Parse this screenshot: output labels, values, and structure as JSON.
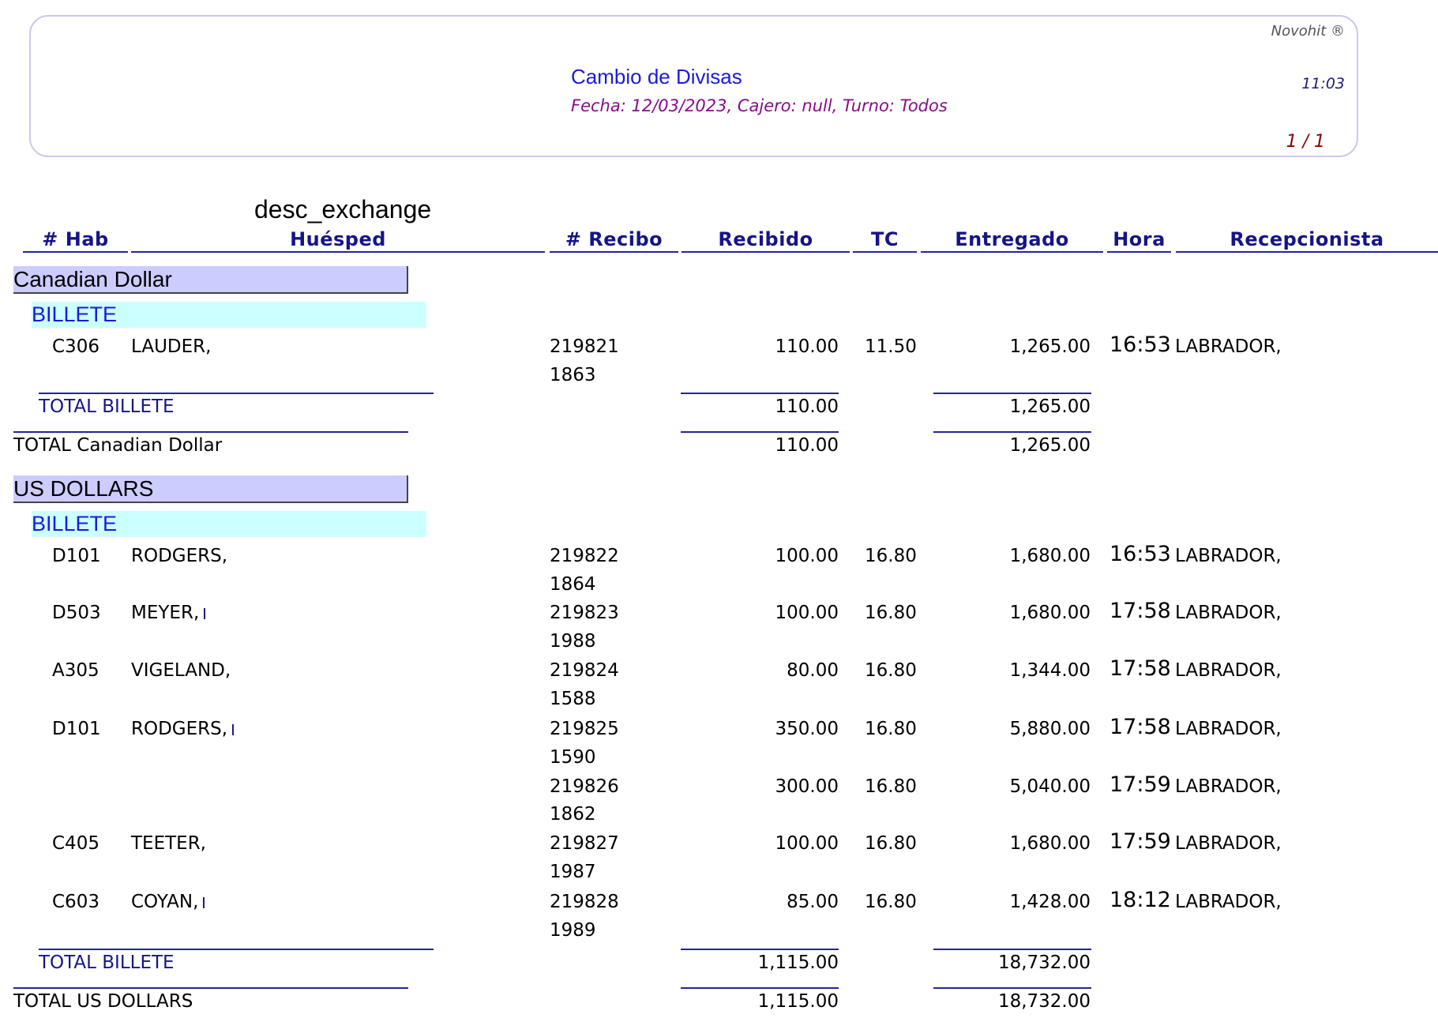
{
  "header": {
    "brand": "Novohit ®",
    "time": "11:03",
    "page": "1 / 1",
    "title": "Cambio de Divisas",
    "subtitle": "Fecha: 12/03/2023,  Cajero: null, Turno: Todos"
  },
  "desc_label": "desc_exchange",
  "columns": {
    "hab": "# Hab",
    "huesped": "Huésped",
    "recibo": "# Recibo",
    "recibido": "Recibido",
    "tc": "TC",
    "entregado": "Entregado",
    "hora": "Hora",
    "recepcionista": "Recepcionista"
  },
  "groups": [
    {
      "name": "Canadian Dollar",
      "subgroup": "BILLETE",
      "rows": [
        {
          "hab": "C306",
          "huesped": "LAUDER,",
          "recibo": "219821",
          "recibo2": "1863",
          "recibido": "110.00",
          "tc": "11.50",
          "entregado": "1,265.00",
          "hora": "16:53",
          "recep": "LABRADOR,"
        }
      ],
      "sub_total_label": "TOTAL BILLETE",
      "sub_total_recibido": "110.00",
      "sub_total_entregado": "1,265.00",
      "total_label": "TOTAL Canadian Dollar",
      "total_recibido": "110.00",
      "total_entregado": "1,265.00"
    },
    {
      "name": "US DOLLARS",
      "subgroup": "BILLETE",
      "rows": [
        {
          "hab": "D101",
          "huesped": "RODGERS,",
          "recibo": "219822",
          "recibo2": "1864",
          "recibido": "100.00",
          "tc": "16.80",
          "entregado": "1,680.00",
          "hora": "16:53",
          "recep": "LABRADOR,"
        },
        {
          "hab": "D503",
          "huesped": "MEYER,",
          "recibo": "219823",
          "recibo2": "1988",
          "recibido": "100.00",
          "tc": "16.80",
          "entregado": "1,680.00",
          "hora": "17:58",
          "recep": "LABRADOR,"
        },
        {
          "hab": "A305",
          "huesped": "VIGELAND,",
          "recibo": "219824",
          "recibo2": "1588",
          "recibido": "80.00",
          "tc": "16.80",
          "entregado": "1,344.00",
          "hora": "17:58",
          "recep": "LABRADOR,"
        },
        {
          "hab": "D101",
          "huesped": "RODGERS,",
          "recibo": "219825",
          "recibo2": "1590",
          "recibido": "350.00",
          "tc": "16.80",
          "entregado": "5,880.00",
          "hora": "17:58",
          "recep": "LABRADOR,"
        },
        {
          "hab": "",
          "huesped": "",
          "recibo": "219826",
          "recibo2": "1862",
          "recibido": "300.00",
          "tc": "16.80",
          "entregado": "5,040.00",
          "hora": "17:59",
          "recep": "LABRADOR,"
        },
        {
          "hab": "C405",
          "huesped": "TEETER,",
          "recibo": "219827",
          "recibo2": "1987",
          "recibido": "100.00",
          "tc": "16.80",
          "entregado": "1,680.00",
          "hora": "17:59",
          "recep": "LABRADOR,"
        },
        {
          "hab": "C603",
          "huesped": "COYAN,",
          "recibo": "219828",
          "recibo2": "1989",
          "recibido": "85.00",
          "tc": "16.80",
          "entregado": "1,428.00",
          "hora": "18:12",
          "recep": "LABRADOR,"
        }
      ],
      "sub_total_label": "TOTAL BILLETE",
      "sub_total_recibido": "1,115.00",
      "sub_total_entregado": "18,732.00",
      "total_label": "TOTAL US DOLLARS",
      "total_recibido": "1,115.00",
      "total_entregado": "18,732.00"
    }
  ]
}
